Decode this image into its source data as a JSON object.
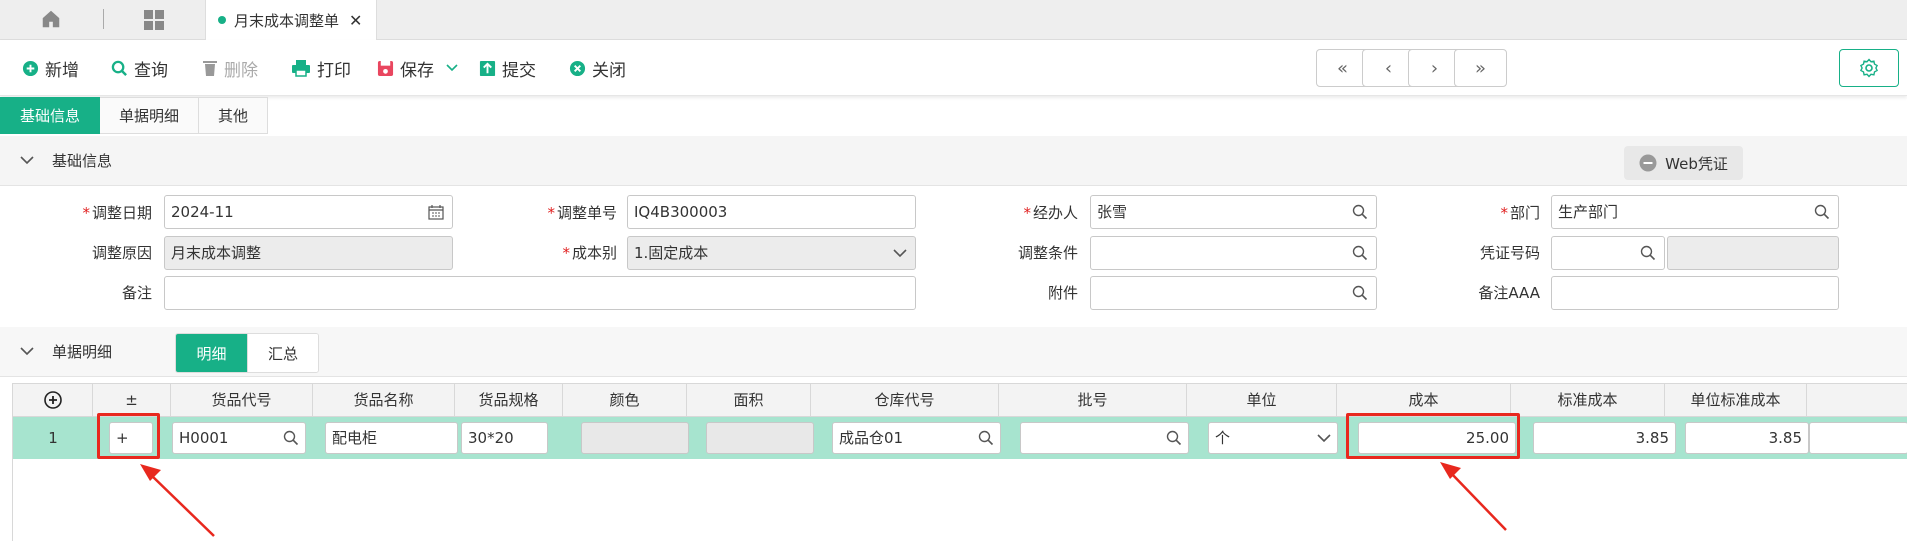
{
  "tabbar": {
    "doc_tab": "月末成本调整单",
    "close": "✕"
  },
  "toolbar": {
    "new": "新增",
    "query": "查询",
    "delete": "删除",
    "print": "打印",
    "save": "保存",
    "submit": "提交",
    "close": "关闭"
  },
  "nav": {
    "first": "«",
    "prev": "‹",
    "next": "›",
    "last": "»"
  },
  "page_tabs": [
    "基础信息",
    "单据明细",
    "其他"
  ],
  "basic": {
    "section_title": "基础信息",
    "web_voucher": "Web凭证",
    "fields": {
      "adjust_date": {
        "label": "调整日期",
        "value": "2024-11"
      },
      "adjust_no": {
        "label": "调整单号",
        "value": "IQ4B300003"
      },
      "handler": {
        "label": "经办人",
        "value": "张雪"
      },
      "dept": {
        "label": "部门",
        "value": "生产部门"
      },
      "reason": {
        "label": "调整原因",
        "value": "月末成本调整"
      },
      "cost_type": {
        "label": "成本别",
        "value": "1.固定成本"
      },
      "condition": {
        "label": "调整条件",
        "value": ""
      },
      "voucher_no": {
        "label": "凭证号码",
        "value": ""
      },
      "remark": {
        "label": "备注",
        "value": ""
      },
      "attachment": {
        "label": "附件",
        "value": ""
      },
      "remark_aaa": {
        "label": "备注AAA",
        "value": ""
      }
    }
  },
  "detail": {
    "section_title": "单据明细",
    "tabs": [
      "明细",
      "汇总"
    ],
    "columns": [
      "±",
      "货品代号",
      "货品名称",
      "货品规格",
      "颜色",
      "面积",
      "仓库代号",
      "批号",
      "单位",
      "成本",
      "标准成本",
      "单位标准成本"
    ],
    "rows": [
      {
        "no": "1",
        "pm": "+",
        "item_code": "H0001",
        "item_name": "配电柜",
        "spec": "30*20",
        "color": "",
        "area": "",
        "warehouse": "成品仓01",
        "batch": "",
        "unit": "个",
        "cost": "25.00",
        "std_cost": "3.85",
        "unit_std_cost": "3.85"
      }
    ]
  },
  "colors": {
    "accent": "#17b087",
    "row_highlight": "#a7e4cf",
    "annotation": "#e8281e"
  }
}
